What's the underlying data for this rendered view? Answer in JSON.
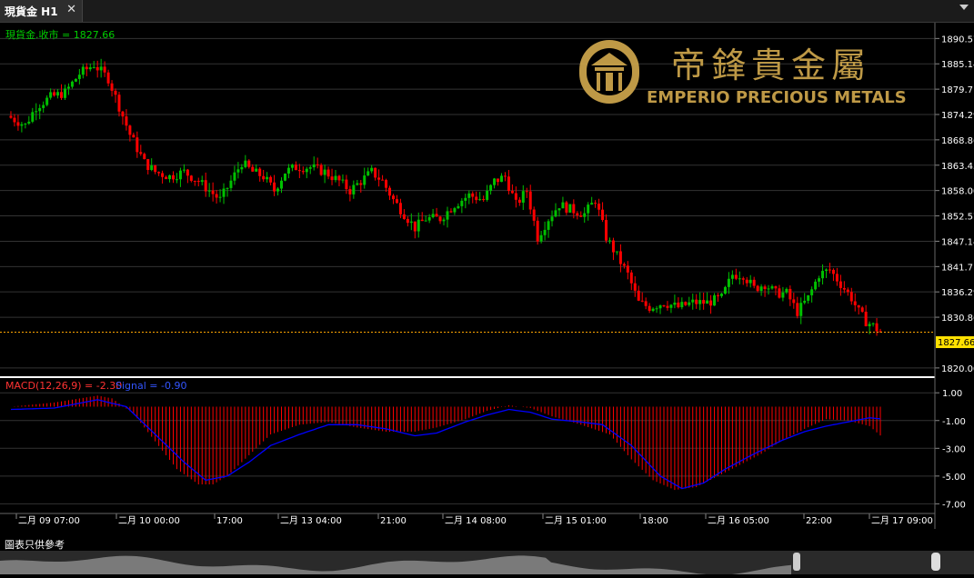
{
  "tab": {
    "title": "現貨金 H1",
    "close_glyph": "✕"
  },
  "price_panel": {
    "label": "現貨金.收市 = 1827.66",
    "current_price": 1827.66,
    "current_price_label": "1827.66",
    "y_axis": {
      "ticks": [
        "1890.57",
        "1885.14",
        "1879.71",
        "1874.29",
        "1868.86",
        "1863.43",
        "1858.00",
        "1852.57",
        "1847.14",
        "1841.71",
        "1836.29",
        "1830.86",
        "1820.00"
      ],
      "min": 1819.0,
      "max": 1892.0
    }
  },
  "macd_panel": {
    "label_macd": "MACD(12,26,9) = -2.30",
    "label_signal": "Signal = -0.90",
    "y_axis": {
      "ticks": [
        "1.00",
        "-1.00",
        "-3.00",
        "-5.00",
        "-7.00"
      ],
      "min": -7.0,
      "max": 1.0
    }
  },
  "x_axis": {
    "labels": [
      "二月 09 07:00",
      "二月 10 00:00",
      "17:00",
      "二月 13 04:00",
      "21:00",
      "二月 14 08:00",
      "二月 15 01:00",
      "18:00",
      "二月 16 05:00",
      "22:00",
      "二月 17 09:00"
    ]
  },
  "watermark": {
    "brand_cn": "帝鋒貴金屬",
    "brand_en": "EMPERIO PRECIOUS METALS"
  },
  "footer": {
    "note": "圖表只供參考"
  },
  "colors": {
    "up": "#00c000",
    "down": "#ff0000",
    "signal": "#0000ff",
    "price_line": "#ffa500",
    "grid": "#333333",
    "gold": "#c9a24a"
  },
  "chart_data": {
    "type": "candlestick",
    "price_key_points": [
      [
        0,
        1874
      ],
      [
        5,
        1872
      ],
      [
        8,
        1876
      ],
      [
        12,
        1878
      ],
      [
        16,
        1879
      ],
      [
        20,
        1883
      ],
      [
        24,
        1885
      ],
      [
        28,
        1882
      ],
      [
        31,
        1876
      ],
      [
        34,
        1870
      ],
      [
        38,
        1864
      ],
      [
        41,
        1862
      ],
      [
        45,
        1861
      ],
      [
        49,
        1862
      ],
      [
        53,
        1860
      ],
      [
        56,
        1858
      ],
      [
        59,
        1856
      ],
      [
        62,
        1860
      ],
      [
        65,
        1864
      ],
      [
        68,
        1862
      ],
      [
        71,
        1861
      ],
      [
        74,
        1858
      ],
      [
        77,
        1862
      ],
      [
        80,
        1863
      ],
      [
        84,
        1863
      ],
      [
        88,
        1862
      ],
      [
        92,
        1860
      ],
      [
        95,
        1858
      ],
      [
        98,
        1860
      ],
      [
        101,
        1862
      ],
      [
        104,
        1860
      ],
      [
        107,
        1856
      ],
      [
        110,
        1853
      ],
      [
        113,
        1850
      ],
      [
        116,
        1852
      ],
      [
        120,
        1852
      ],
      [
        124,
        1855
      ],
      [
        128,
        1857
      ],
      [
        132,
        1856
      ],
      [
        135,
        1860
      ],
      [
        138,
        1861
      ],
      [
        141,
        1855
      ],
      [
        144,
        1858
      ],
      [
        147,
        1848
      ],
      [
        150,
        1852
      ],
      [
        153,
        1855
      ],
      [
        156,
        1854
      ],
      [
        160,
        1853
      ],
      [
        163,
        1856
      ],
      [
        166,
        1848
      ],
      [
        169,
        1844
      ],
      [
        172,
        1840
      ],
      [
        175,
        1834
      ],
      [
        178,
        1833
      ],
      [
        182,
        1834
      ],
      [
        186,
        1833
      ],
      [
        190,
        1834
      ],
      [
        194,
        1834
      ],
      [
        198,
        1835
      ],
      [
        201,
        1840
      ],
      [
        204,
        1840
      ],
      [
        207,
        1837
      ],
      [
        210,
        1838
      ],
      [
        213,
        1836
      ],
      [
        216,
        1836
      ],
      [
        219,
        1832
      ],
      [
        222,
        1835
      ],
      [
        225,
        1840
      ],
      [
        228,
        1841
      ],
      [
        231,
        1838
      ],
      [
        234,
        1835
      ],
      [
        236,
        1832
      ],
      [
        238,
        1830
      ],
      [
        240,
        1829
      ],
      [
        242,
        1827.66
      ]
    ],
    "macd_key_points": [
      [
        0,
        0.0
      ],
      [
        12,
        0.3
      ],
      [
        24,
        0.8
      ],
      [
        28,
        0.6
      ],
      [
        34,
        -0.5
      ],
      [
        40,
        -2.5
      ],
      [
        46,
        -4.5
      ],
      [
        52,
        -5.6
      ],
      [
        56,
        -5.6
      ],
      [
        60,
        -5.0
      ],
      [
        66,
        -3.5
      ],
      [
        72,
        -2.0
      ],
      [
        80,
        -1.3
      ],
      [
        88,
        -1.1
      ],
      [
        96,
        -1.5
      ],
      [
        104,
        -1.8
      ],
      [
        112,
        -1.8
      ],
      [
        118,
        -1.5
      ],
      [
        126,
        -0.9
      ],
      [
        132,
        -0.3
      ],
      [
        138,
        0.1
      ],
      [
        144,
        -0.1
      ],
      [
        150,
        -0.7
      ],
      [
        158,
        -1.3
      ],
      [
        166,
        -2.0
      ],
      [
        172,
        -3.8
      ],
      [
        178,
        -5.3
      ],
      [
        184,
        -6.0
      ],
      [
        190,
        -5.8
      ],
      [
        196,
        -5.0
      ],
      [
        202,
        -4.2
      ],
      [
        208,
        -3.4
      ],
      [
        214,
        -2.4
      ],
      [
        220,
        -1.6
      ],
      [
        226,
        -0.9
      ],
      [
        232,
        -1.0
      ],
      [
        238,
        -1.4
      ],
      [
        242,
        -2.3
      ]
    ],
    "signal_key_points": [
      [
        0,
        -0.2
      ],
      [
        12,
        -0.1
      ],
      [
        24,
        0.5
      ],
      [
        32,
        0.0
      ],
      [
        40,
        -2.0
      ],
      [
        48,
        -4.0
      ],
      [
        54,
        -5.3
      ],
      [
        60,
        -5.0
      ],
      [
        66,
        -4.0
      ],
      [
        72,
        -2.8
      ],
      [
        80,
        -2.0
      ],
      [
        88,
        -1.3
      ],
      [
        96,
        -1.3
      ],
      [
        104,
        -1.6
      ],
      [
        112,
        -2.1
      ],
      [
        118,
        -1.9
      ],
      [
        126,
        -1.1
      ],
      [
        132,
        -0.6
      ],
      [
        138,
        -0.2
      ],
      [
        144,
        -0.4
      ],
      [
        150,
        -0.9
      ],
      [
        158,
        -1.1
      ],
      [
        164,
        -1.3
      ],
      [
        172,
        -2.8
      ],
      [
        180,
        -5.0
      ],
      [
        186,
        -5.9
      ],
      [
        192,
        -5.5
      ],
      [
        198,
        -4.5
      ],
      [
        206,
        -3.4
      ],
      [
        214,
        -2.4
      ],
      [
        220,
        -1.8
      ],
      [
        226,
        -1.4
      ],
      [
        232,
        -1.1
      ],
      [
        238,
        -0.8
      ],
      [
        242,
        -0.9
      ]
    ],
    "bar_count": 242
  }
}
